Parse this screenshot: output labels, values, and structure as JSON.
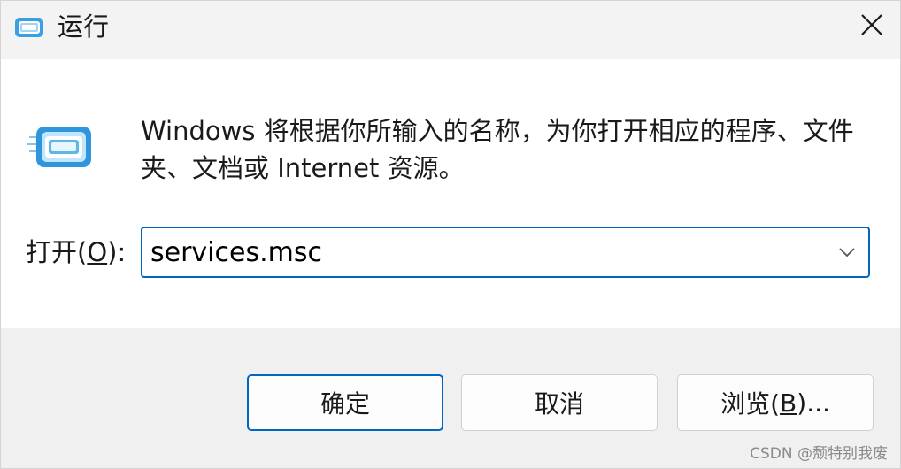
{
  "window": {
    "title": "运行",
    "close_glyph": "✕"
  },
  "body": {
    "description": "Windows 将根据你所输入的名称，为你打开相应的程序、文件夹、文档或 Internet 资源。",
    "open_label_prefix": "打开(",
    "open_label_mnemonic": "O",
    "open_label_suffix": "):",
    "command_value": "services.msc"
  },
  "buttons": {
    "ok_label": "确定",
    "cancel_label": "取消",
    "browse_prefix": "浏览(",
    "browse_mnemonic": "B",
    "browse_suffix": ")..."
  },
  "watermark": "CSDN @颓特别我废",
  "icons": {
    "title": "run-icon",
    "main": "run-large-icon",
    "close": "close-icon",
    "dropdown": "chevron-down-icon"
  },
  "colors": {
    "accent": "#0067c0",
    "titlebar": "#f3f3f3",
    "footer": "#f0f0f0"
  }
}
